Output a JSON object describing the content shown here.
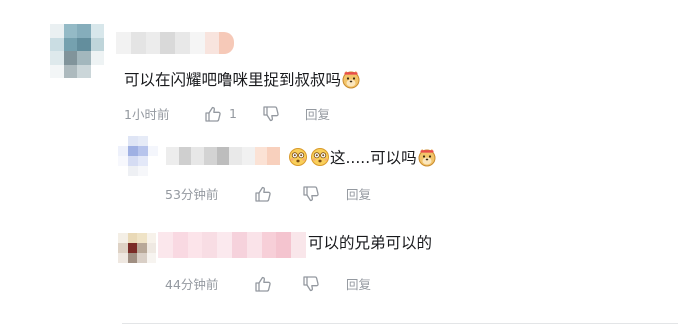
{
  "comments": {
    "main": {
      "text": "可以在闪耀吧噜咪里捉到叔叔吗",
      "time": "1小时前",
      "likes": "1",
      "reply_label": "回复"
    },
    "reply1": {
      "text": "这.....可以吗",
      "time": "53分钟前",
      "reply_label": "回复"
    },
    "reply2": {
      "text": "可以的兄弟可以的",
      "time": "44分钟前",
      "reply_label": "回复"
    }
  },
  "colors": {
    "meta_text": "#9499a0",
    "comment_text": "#18191c",
    "divider": "#e3e5e7"
  },
  "icons": {
    "like": "thumb-up-icon",
    "dislike": "thumb-down-icon",
    "doge_emoji": "doge-emoji-icon",
    "dizzy_emoji": "dizzy-face-emoji-icon"
  }
}
